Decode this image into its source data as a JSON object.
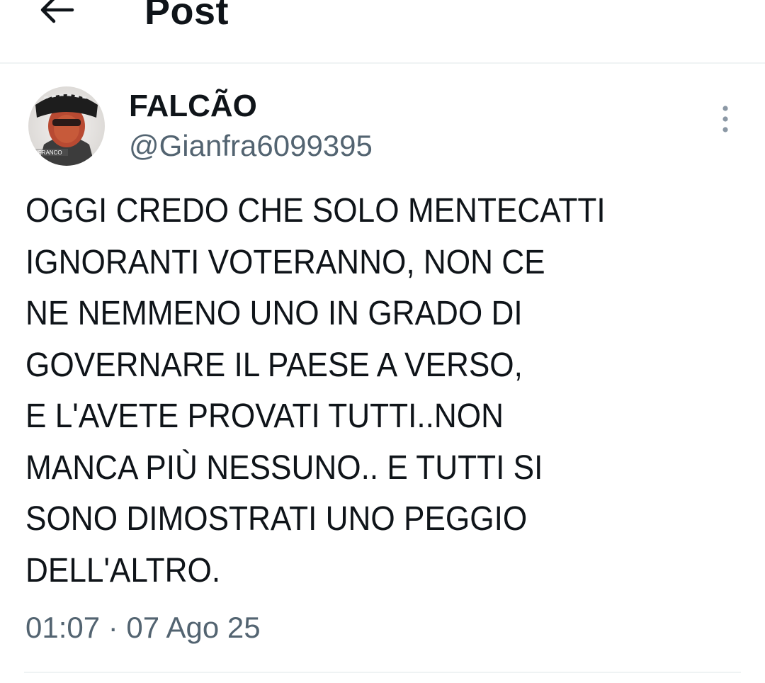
{
  "header": {
    "title": "Post",
    "back_icon": "arrow-left-icon"
  },
  "author": {
    "display_name": "FALCÃO",
    "handle": "@Gianfra6099395",
    "avatar_caption": "NFRANCO"
  },
  "post": {
    "text": "OGGI CREDO CHE SOLO MENTECATTI\nIGNORANTI VOTERANNO, NON CE\nNE NEMMENO UNO IN GRADO DI\nGOVERNARE IL PAESE A VERSO,\nE L'AVETE PROVATI TUTTI..NON\nMANCA PIÙ NESSUNO.. E TUTTI SI\nSONO DIMOSTRATI UNO PEGGIO\nDELL'ALTRO.",
    "timestamp": "01:07 · 07 Ago 25"
  },
  "icons": {
    "back": "arrow-left-icon",
    "more": "vertical-ellipsis-icon"
  },
  "colors": {
    "text_primary": "#0f1419",
    "text_secondary": "#536471",
    "divider": "#eff3f4",
    "background": "#ffffff"
  }
}
